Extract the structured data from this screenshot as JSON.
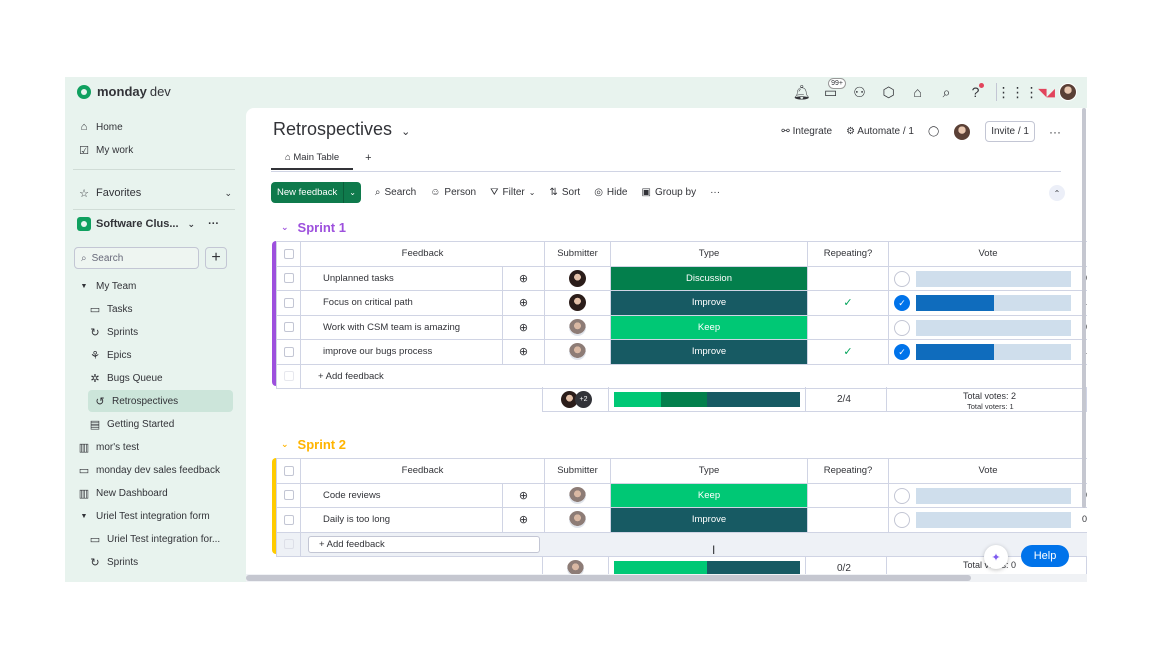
{
  "app": {
    "brand": "monday",
    "brand_suffix": "dev"
  },
  "topbar": {
    "updates_badge": "99+"
  },
  "sidebar": {
    "home": "Home",
    "my_work": "My work",
    "favorites": "Favorites",
    "workspace": "Software Clus...",
    "search_placeholder": "Search",
    "my_team": "My Team",
    "items": [
      "Tasks",
      "Sprints",
      "Epics",
      "Bugs Queue",
      "Retrospectives",
      "Getting Started"
    ],
    "boards": [
      "mor's test",
      "monday dev sales feedback",
      "New Dashboard"
    ],
    "uriel_folder": "Uriel Test integration form",
    "uriel_items": [
      "Uriel Test integration for...",
      "Sprints"
    ]
  },
  "board": {
    "title": "Retrospectives",
    "integrate": "Integrate",
    "automate": "Automate / 1",
    "invite": "Invite / 1",
    "tab_main": "Main Table",
    "tab_add": "+"
  },
  "toolbar": {
    "new_item": "New feedback",
    "search": "Search",
    "person": "Person",
    "filter": "Filter",
    "sort": "Sort",
    "hide": "Hide",
    "group_by": "Group by"
  },
  "columns": [
    "Feedback",
    "Submitter",
    "Type",
    "Repeating?",
    "Vote"
  ],
  "colors": {
    "sprint1": "#9d50dd",
    "sprint2": "#ffcb00",
    "discussion": "#037f4c",
    "improve": "#175a63",
    "keep": "#00c875",
    "vote_fill": "#0f6cbd"
  },
  "groups": [
    {
      "name": "Sprint 1",
      "rows": [
        {
          "feedback": "Unplanned tasks",
          "type": "Discussion",
          "repeating": false,
          "voted": false,
          "vote": "0",
          "vote_fraction": 0
        },
        {
          "feedback": "Focus on critical path",
          "type": "Improve",
          "repeating": true,
          "voted": true,
          "vote": "1",
          "vote_fraction": 0.5
        },
        {
          "feedback": "Work with CSM team is amazing",
          "type": "Keep",
          "repeating": false,
          "voted": false,
          "vote": "0",
          "vote_fraction": 0
        },
        {
          "feedback": "improve our bugs process",
          "type": "Improve",
          "repeating": true,
          "voted": true,
          "vote": "1",
          "vote_fraction": 0.5
        }
      ],
      "add_label": "+ Add feedback",
      "summary": {
        "people_extra": "+2",
        "repeating": "2/4",
        "total_votes": "Total votes: 2",
        "total_voters": "Total voters: 1"
      }
    },
    {
      "name": "Sprint 2",
      "rows": [
        {
          "feedback": "Code reviews",
          "type": "Keep",
          "repeating": false,
          "voted": false,
          "vote": "0",
          "vote_fraction": 0
        },
        {
          "feedback": "Daily is too long",
          "type": "Improve",
          "repeating": false,
          "voted": false,
          "vote": "0",
          "vote_fraction": 0
        }
      ],
      "add_label": "+ Add feedback",
      "summary": {
        "repeating": "0/2",
        "total_votes": "Total votes: 0"
      }
    }
  ],
  "help": "Help"
}
